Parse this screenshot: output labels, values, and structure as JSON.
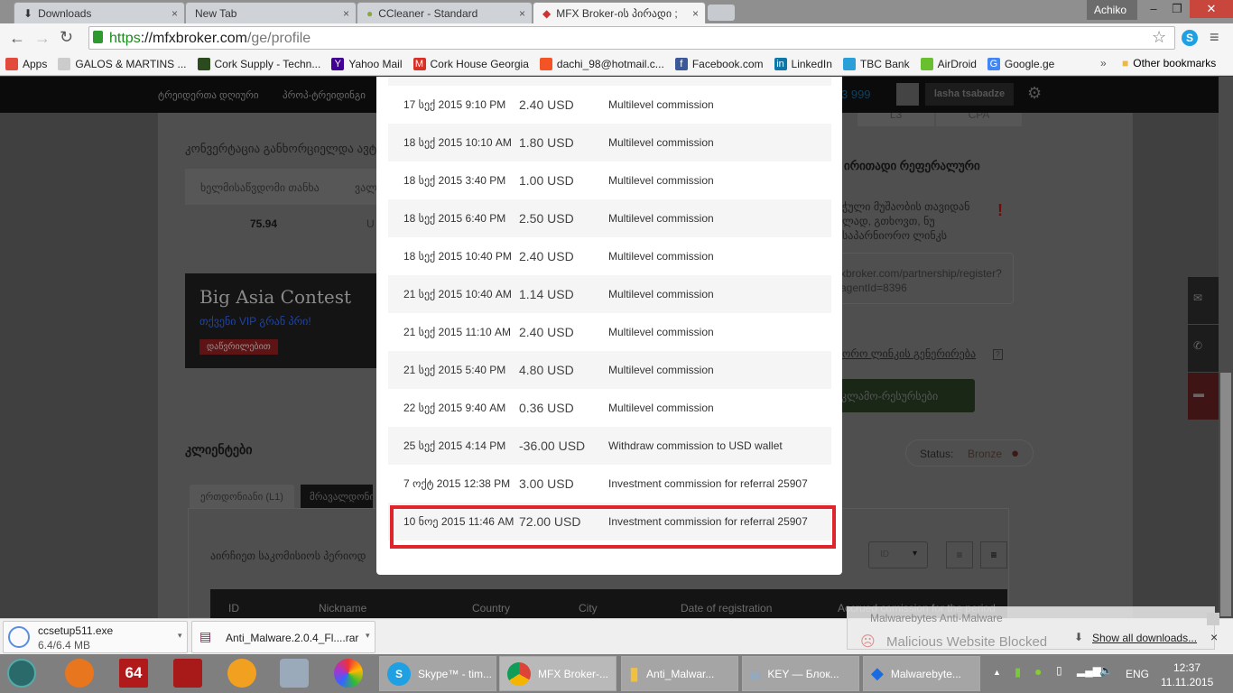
{
  "browser": {
    "tabs": [
      {
        "label": "Downloads",
        "icon": "download-icon"
      },
      {
        "label": "New Tab"
      },
      {
        "label": "CCleaner - Standard",
        "icon": "ccleaner-icon"
      },
      {
        "label": "MFX Broker-ის პირადი ;",
        "icon": "mfx-icon",
        "active": true
      }
    ],
    "profile_name": "Achiko",
    "url_scheme": "https",
    "url_host": "://mfxbroker.com",
    "url_path": "/ge/profile",
    "bookmarks": [
      {
        "label": "Apps",
        "color": "#e24a3b"
      },
      {
        "label": "GALOS & MARTINS ...",
        "color": "#cccccc"
      },
      {
        "label": "Cork Supply - Techn...",
        "color": "#2b4a1d"
      },
      {
        "label": "Yahoo Mail",
        "color": "#410093",
        "glyph": "Y"
      },
      {
        "label": "Cork House Georgia",
        "color": "#d93025",
        "glyph": "M"
      },
      {
        "label": "dachi_98@hotmail.c...",
        "color": "#f35325"
      },
      {
        "label": "Facebook.com",
        "color": "#3b5998",
        "glyph": "f"
      },
      {
        "label": "LinkedIn",
        "color": "#0e76a8",
        "glyph": "in"
      },
      {
        "label": "TBC Bank",
        "color": "#2a9fd8"
      },
      {
        "label": "AirDroid",
        "color": "#6abf2e"
      },
      {
        "label": "Google.ge",
        "color": "#4285f4",
        "glyph": "G"
      }
    ],
    "bookmarks_more": "»",
    "other_bookmarks": "Other bookmarks"
  },
  "site": {
    "nav": [
      "ტრეიდერთა დღიური",
      "პროპ-ტრეიდინგი"
    ],
    "phone_fragment": "3 999",
    "user_name": "lasha tsabadze",
    "conversion_text": "კონვერტაცია განხორციელდა ავტო",
    "balance_header": "ხელმისაწვდომი თანხა",
    "balance_header2": "ვალ",
    "balance_value": "75.94",
    "balance_currency": "U",
    "level_tabs": [
      "L3",
      "CPA"
    ],
    "banner_title": "Big Asia Contest",
    "banner_subtitle": "თქვენი VIP გრან პრი!",
    "banner_button": "დაწვრილებით",
    "ref_heading": "ირითადი რეფერალური",
    "ref_warning": [
      "ჭული მუშაობის თავიდან",
      "ლად, გთხოვთ, ნუ",
      "საპარნიორო ლინკს"
    ],
    "ref_link": [
      "xbroker.com/partnership/register?",
      "agentId=8396"
    ],
    "gen_link": "ორო ლინკის გენერირება",
    "ads_button": "კლამო-რესურსები",
    "clients_heading": "კლიენტები",
    "status_label": "Status:",
    "status_value": "Bronze",
    "client_tabs": [
      "ერთდონიანი (L1)",
      "მრავალდონი"
    ],
    "period_label": "აირჩიეთ საკომისიოს პერიოდ",
    "sort_value": "ID",
    "table_headers": [
      "ID",
      "Nickname",
      "Country",
      "City",
      "Date of registration",
      "Accrued comission for the period"
    ]
  },
  "modal": {
    "rows": [
      {
        "date": "17 სექ 2015 9:10 PM",
        "amount": "2.40 USD",
        "type": "Multilevel commission"
      },
      {
        "date": "18 სექ 2015 10:10 AM",
        "amount": "1.80 USD",
        "type": "Multilevel commission"
      },
      {
        "date": "18 სექ 2015 3:40 PM",
        "amount": "1.00 USD",
        "type": "Multilevel commission"
      },
      {
        "date": "18 სექ 2015 6:40 PM",
        "amount": "2.50 USD",
        "type": "Multilevel commission"
      },
      {
        "date": "18 სექ 2015 10:40 PM",
        "amount": "2.40 USD",
        "type": "Multilevel commission"
      },
      {
        "date": "21 სექ 2015 10:40 AM",
        "amount": "1.14 USD",
        "type": "Multilevel commission"
      },
      {
        "date": "21 სექ 2015 11:10 AM",
        "amount": "2.40 USD",
        "type": "Multilevel commission"
      },
      {
        "date": "21 სექ 2015 5:40 PM",
        "amount": "4.80 USD",
        "type": "Multilevel commission"
      },
      {
        "date": "22 სექ 2015 9:40 AM",
        "amount": "0.36 USD",
        "type": "Multilevel commission"
      },
      {
        "date": "25 სექ 2015 4:14 PM",
        "amount": "-36.00 USD",
        "type": "Withdraw commission to USD wallet"
      },
      {
        "date": "7 ოქტ 2015 12:38 PM",
        "amount": "3.00 USD",
        "type": "Investment commission for referral 25907"
      },
      {
        "date": "10 ნოე 2015 11:46 AM",
        "amount": "72.00 USD",
        "type": "Investment commission for referral 25907",
        "highlighted": true
      }
    ]
  },
  "downloads": [
    {
      "name": "ccsetup511.exe",
      "size": "6.4/6.4 MB"
    },
    {
      "name": "Anti_Malware.2.0.4_Fl....rar"
    }
  ],
  "show_all_downloads": "Show all downloads...",
  "notification": {
    "app": "Malwarebytes Anti-Malware",
    "message": "Malicious Website Blocked"
  },
  "taskbar": {
    "windows": [
      "Skype™ - tim...",
      "MFX Broker-...",
      "Anti_Malwar...",
      "KEY — Блок...",
      "Malwarebyte..."
    ],
    "lang": "ENG",
    "time": "12:37",
    "date": "11.11.2015"
  }
}
